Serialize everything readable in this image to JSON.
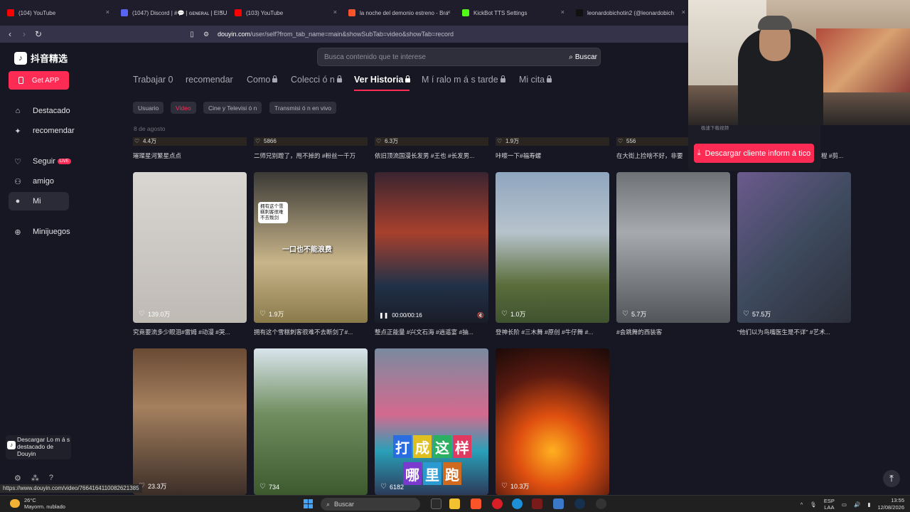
{
  "browser": {
    "tabs": [
      {
        "title": "(104) YouTube",
        "color": "#ff0000"
      },
      {
        "title": "(1047) Discord | #💬 | ɢᴇɴᴇʀᴀʟ | EISU",
        "color": "#5865f2"
      },
      {
        "title": "(103) YouTube",
        "color": "#ff0000"
      },
      {
        "title": "la noche del demonio estreno - Bra",
        "color": "#fb542b"
      },
      {
        "title": "KickBot TTS Settings",
        "color": "#53fc18"
      },
      {
        "title": "leonardobichotin2 (@leonardobich",
        "color": "#111111"
      }
    ],
    "url_domain": "douyin.com",
    "url_path": "/user/self?from_tab_name=main&showSubTab=video&showTab=record",
    "status_url": "https://www.douyin.com/video/7664164110082621385"
  },
  "sidebar": {
    "logo_text": "抖音精选",
    "get_app_label": "Get APP",
    "items": [
      {
        "label": "Destacado",
        "icon": "home-icon"
      },
      {
        "label": "recomendar",
        "icon": "sparkle-icon"
      },
      {
        "label": "Seguir",
        "icon": "follow-icon",
        "badge": "LIVE"
      },
      {
        "label": "amigo",
        "icon": "friends-icon"
      },
      {
        "label": "Mi",
        "icon": "person-icon"
      },
      {
        "label": "Minijuegos",
        "icon": "gamepad-icon"
      }
    ],
    "promo_text": "Descargar Lo m á s destacado de Douyin"
  },
  "search": {
    "placeholder": "Busca contenido que te interese",
    "button_label": "Buscar"
  },
  "profile_tabs": [
    {
      "label": "Trabajar 0",
      "locked": false
    },
    {
      "label": "recomendar",
      "locked": false
    },
    {
      "label": "Como",
      "locked": true
    },
    {
      "label": "Colecci ó n",
      "locked": true
    },
    {
      "label": "Ver Historia",
      "locked": true,
      "active": true
    },
    {
      "label": "M í ralo m á s tarde",
      "locked": true
    },
    {
      "label": "Mi cita",
      "locked": true
    }
  ],
  "sub_tabs": [
    {
      "label": "Usuario"
    },
    {
      "label": "Video",
      "active": true
    },
    {
      "label": "Cine y Televisi ó n"
    },
    {
      "label": "Transmisi ó n en vivo"
    }
  ],
  "date_label": "8 de agosto",
  "top_row": [
    {
      "likes": "4.4万",
      "caption": "璀璨星河繁星点点"
    },
    {
      "likes": "5866",
      "caption": "二师兄别蹬了，甩不掉的 #粉丝一千万"
    },
    {
      "likes": "6.3万",
      "caption": "依旧顶流国漫长发男 #王也 #长发男..."
    },
    {
      "likes": "1.9万",
      "caption": "咔嚓一下#福寿螺"
    },
    {
      "likes": "556",
      "caption": "在大街上捡啥不好，非要"
    },
    {
      "likes": "",
      "caption": "程 #剪..."
    }
  ],
  "videos": [
    {
      "likes": "139.0万",
      "caption": "究竟要流多少眼泪#雷姆 #动漫 #哭...",
      "bg": "linear-gradient(180deg,#d9d6d2,#bfbab4)"
    },
    {
      "likes": "1.9万",
      "caption": "拥有这个雪糕刺客很难不去断剑了#...",
      "bg": "linear-gradient(180deg,#3b3a36,#c9b58a 60%,#8a7a4a)",
      "overlay": "一口也不能浪费",
      "bubble": "拥有这个雪糕刺客很难不去叛剑"
    },
    {
      "likes": "",
      "caption": "整点正能量 #兴文石海 #逍遥宴 #抽...",
      "bg": "linear-gradient(180deg,#3a2430,#a8402d 40%,#213148 75%,#1a1d28)",
      "time": "00:00/00:16"
    },
    {
      "likes": "1.0万",
      "caption": "登神长阶 #三木舞 #原创 #牛仔舞 #...",
      "bg": "linear-gradient(180deg,#8fa6bf,#b7c3cc 40%,#5a6d3a 75%,#3f5230)"
    },
    {
      "likes": "5.7万",
      "caption": "#会跳舞的西装客",
      "bg": "linear-gradient(180deg,#6e7176,#a6a9ad 40%,#52555a)"
    },
    {
      "likes": "57.5万",
      "caption": "\"他们以为鸟嘴医生是不详\" #艺术...",
      "bg": "linear-gradient(135deg,#6b5a8e,#3e4a5e 50%,#2c2f3a)"
    },
    {
      "likes": "23.3万",
      "caption": "",
      "bg": "linear-gradient(180deg,#6a4a34,#a5805e 40%,#3c2e28)"
    },
    {
      "likes": "734",
      "caption": "",
      "bg": "linear-gradient(180deg,#d9e4ec,#6f8d5e 45%,#3c5a2e)"
    },
    {
      "likes": "6182",
      "caption": "",
      "bg": "linear-gradient(180deg,#7a8aa0,#d46a8e 45%,#2aa0b8 70%,#2c3a5a)",
      "overlay_chars": [
        "打",
        "成",
        "这",
        "样",
        "哪",
        "里",
        "跑"
      ]
    },
    {
      "likes": "10.3万",
      "caption": "",
      "bg": "radial-gradient(circle at 50% 70%,#ffb020,#e05010 30%,#5a1a10 65%,#1a0a08)"
    }
  ],
  "download_popup": {
    "label": "Descargar cliente inform á tico",
    "peek": "极速下载视频"
  },
  "taskbar": {
    "weather_temp": "26°C",
    "weather_desc": "Mayorm. nublado",
    "search_label": "Buscar",
    "lang": "ESP",
    "lang2": "LAA",
    "time": "13:55",
    "date": "12/08/2026"
  },
  "colors": {
    "accent": "#fe2c55",
    "bg": "#161722"
  }
}
